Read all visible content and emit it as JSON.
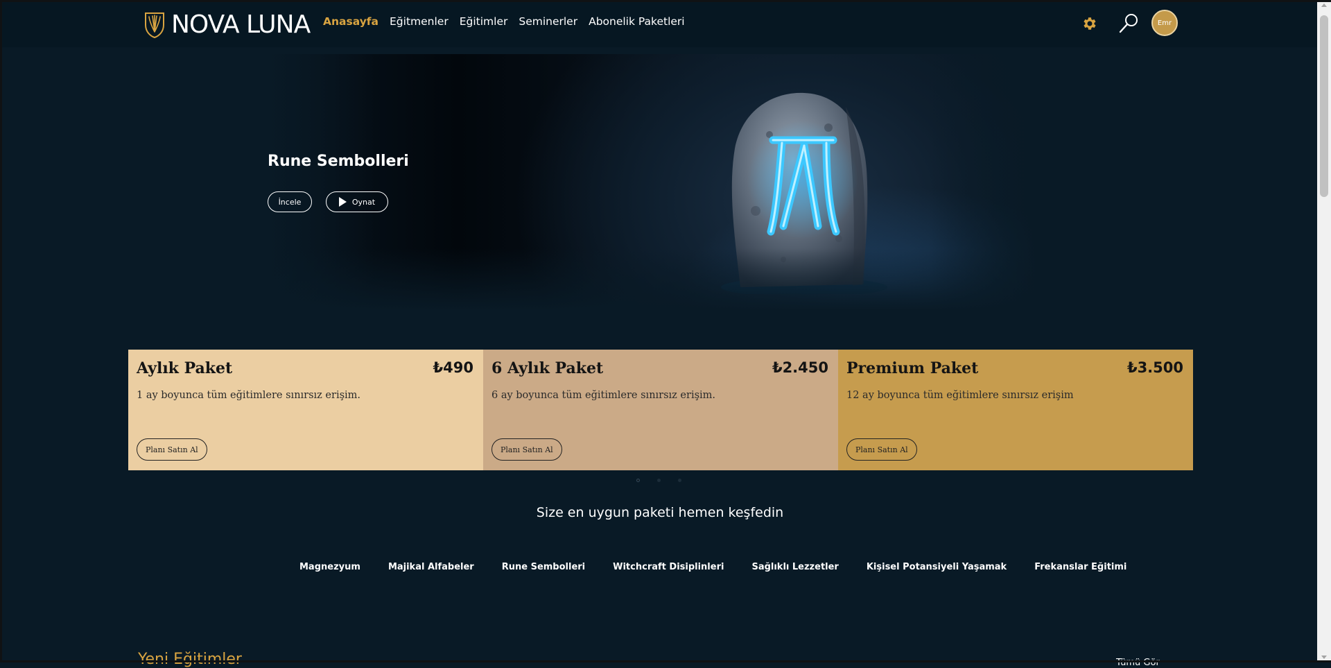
{
  "brand": {
    "name": "NOVA LUNA",
    "logo_icon": "crown-shield-emblem",
    "accent_color": "#d9a441"
  },
  "nav": {
    "items": [
      {
        "label": "Anasayfa",
        "active": true
      },
      {
        "label": "Eğitmenler",
        "active": false
      },
      {
        "label": "Eğitimler",
        "active": false
      },
      {
        "label": "Seminerler",
        "active": false
      },
      {
        "label": "Abonelik Paketleri",
        "active": false
      }
    ]
  },
  "header_icons": {
    "settings": "gear-icon",
    "search": "search-icon"
  },
  "user": {
    "avatar_text": "Emr"
  },
  "hero": {
    "title": "Rune Sembolleri",
    "buttons": {
      "inspect": "İncele",
      "play": "Oynat"
    },
    "image": "glowing-rune-stone"
  },
  "packages": [
    {
      "name": "Aylık Paket",
      "price": "₺490",
      "description": "1 ay boyunca tüm eğitimlere sınırsız erişim.",
      "button": "Planı Satın Al",
      "color": "#ebcea2"
    },
    {
      "name": "6 Aylık Paket",
      "price": "₺2.450",
      "description": "6 ay boyunca tüm eğitimlere sınırsız erişim.",
      "button": "Planı Satın Al",
      "color": "#cbaa87"
    },
    {
      "name": "Premium Paket",
      "price": "₺3.500",
      "description": "12 ay boyunca tüm eğitimlere sınırsız erişim",
      "button": "Planı Satın Al",
      "color": "#c69c4e"
    }
  ],
  "carousel": {
    "dots": 3,
    "active_index": 0
  },
  "tagline": "Size en uygun paketi hemen keşfedin",
  "categories": [
    "Magnezyum",
    "Majikal Alfabeler",
    "Rune Sembolleri",
    "Witchcraft Disiplinleri",
    "Sağlıklı Lezzetler",
    "Kişisel Potansiyeli Yaşamak",
    "Frekanslar Eğitimi"
  ],
  "new_courses": {
    "title": "Yeni Eğitimler",
    "see_all": "Tümü Gör"
  }
}
